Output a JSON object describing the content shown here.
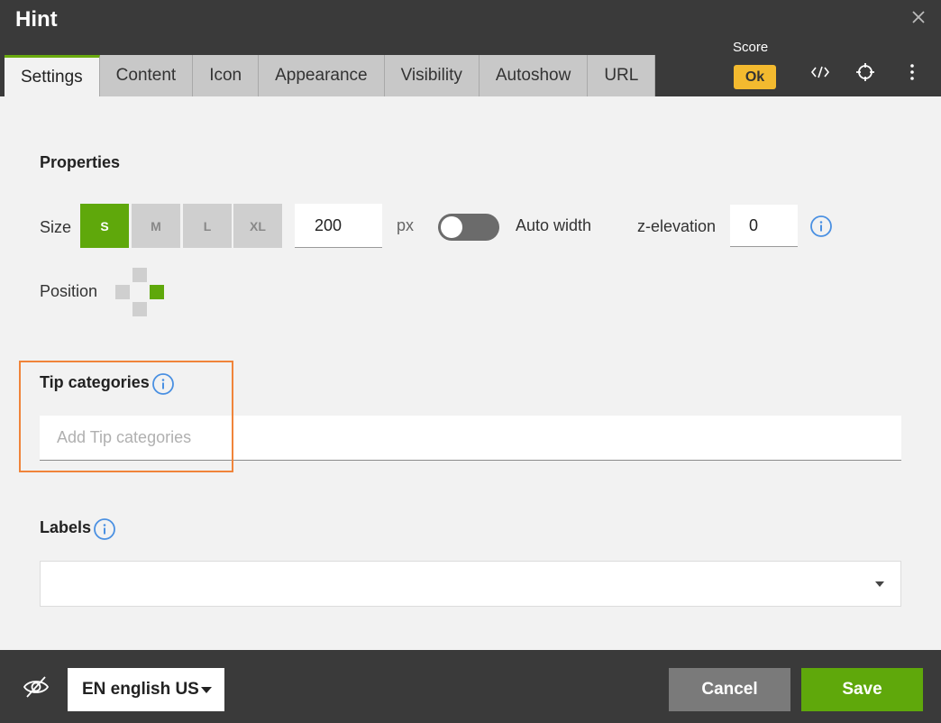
{
  "header": {
    "title": "Hint",
    "tabs": [
      {
        "label": "Settings",
        "active": true
      },
      {
        "label": "Content"
      },
      {
        "label": "Icon"
      },
      {
        "label": "Appearance"
      },
      {
        "label": "Visibility"
      },
      {
        "label": "Autoshow"
      },
      {
        "label": "URL"
      }
    ],
    "score_label": "Score",
    "score_value": "Ok",
    "icons": [
      "close-icon",
      "code-icon",
      "crosshair-icon",
      "more-vertical-icon"
    ]
  },
  "properties": {
    "title": "Properties",
    "size_label": "Size",
    "sizes": [
      "S",
      "M",
      "L",
      "XL"
    ],
    "selected_size": "S",
    "width_value": "200",
    "width_unit": "px",
    "auto_width_label": "Auto width",
    "auto_width_on": false,
    "z_elevation_label": "z-elevation",
    "z_elevation_value": "0",
    "position_label": "Position",
    "position_selected": "right"
  },
  "tip_categories": {
    "title": "Tip categories",
    "placeholder": "Add Tip categories"
  },
  "labels": {
    "title": "Labels",
    "value": ""
  },
  "footer": {
    "language": "EN english US",
    "cancel_label": "Cancel",
    "save_label": "Save"
  },
  "colors": {
    "accent": "#5fa80b",
    "score": "#f3ba2f",
    "highlight": "#f0843a",
    "info": "#4a90e2"
  }
}
